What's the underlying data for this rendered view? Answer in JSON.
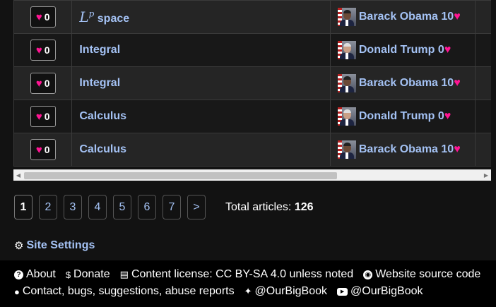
{
  "table": {
    "rows": [
      {
        "likes": "0",
        "title_math": "L",
        "title_math_sup": "p",
        "title_text": "space",
        "author": "Barack Obama",
        "score": "10",
        "avatar": "barack-obama-avatar"
      },
      {
        "likes": "0",
        "title_math": "",
        "title_math_sup": "",
        "title_text": "Integral",
        "author": "Donald Trump",
        "score": "0",
        "avatar": "donald-trump-avatar"
      },
      {
        "likes": "0",
        "title_math": "",
        "title_math_sup": "",
        "title_text": "Integral",
        "author": "Barack Obama",
        "score": "10",
        "avatar": "barack-obama-avatar"
      },
      {
        "likes": "0",
        "title_math": "",
        "title_math_sup": "",
        "title_text": "Calculus",
        "author": "Donald Trump",
        "score": "0",
        "avatar": "donald-trump-avatar"
      },
      {
        "likes": "0",
        "title_math": "",
        "title_math_sup": "",
        "title_text": "Calculus",
        "author": "Barack Obama",
        "score": "10",
        "avatar": "barack-obama-avatar"
      }
    ],
    "heart_icon": "heart-icon",
    "heart_color": "#ff1493"
  },
  "pagination": {
    "pages": [
      "1",
      "2",
      "3",
      "4",
      "5",
      "6",
      "7"
    ],
    "current": "1",
    "next_label": ">",
    "total_label": "Total articles:",
    "total_value": "126"
  },
  "site_settings": {
    "label": "Site Settings",
    "icon": "gear-icon"
  },
  "footer": {
    "about": "About",
    "donate": "Donate",
    "license": "Content license: CC BY-SA 4.0 unless noted",
    "source": "Website source code",
    "contact": "Contact, bugs, suggestions, abuse reports",
    "twitter": "@OurBigBook",
    "youtube": "@OurBigBook"
  },
  "colors": {
    "link": "#a4c2f4",
    "background": "#121212",
    "footer_bg": "#000000"
  }
}
